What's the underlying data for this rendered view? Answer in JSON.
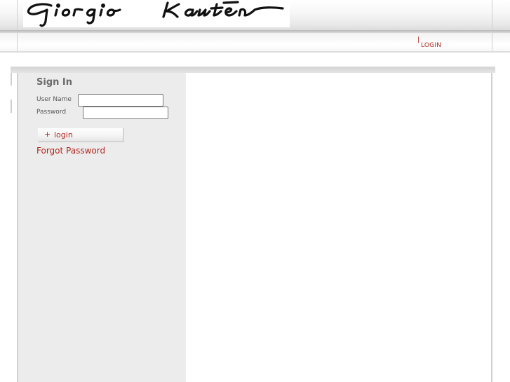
{
  "header": {
    "logo_text": "Giorgio Kauten",
    "nav": {
      "divider": "|",
      "login_label": "LOGIN"
    }
  },
  "signin": {
    "title": "Sign In",
    "username_label": "User Name",
    "username_value": "",
    "password_label": "Password",
    "password_value": "",
    "login_button_label": "login",
    "login_button_icon": "plus-icon",
    "forgot_password_label": "Forgot Password"
  },
  "colors": {
    "accent": "#b3261e",
    "sidebar_bg": "#ececec",
    "title_text": "#6a6a6a"
  }
}
